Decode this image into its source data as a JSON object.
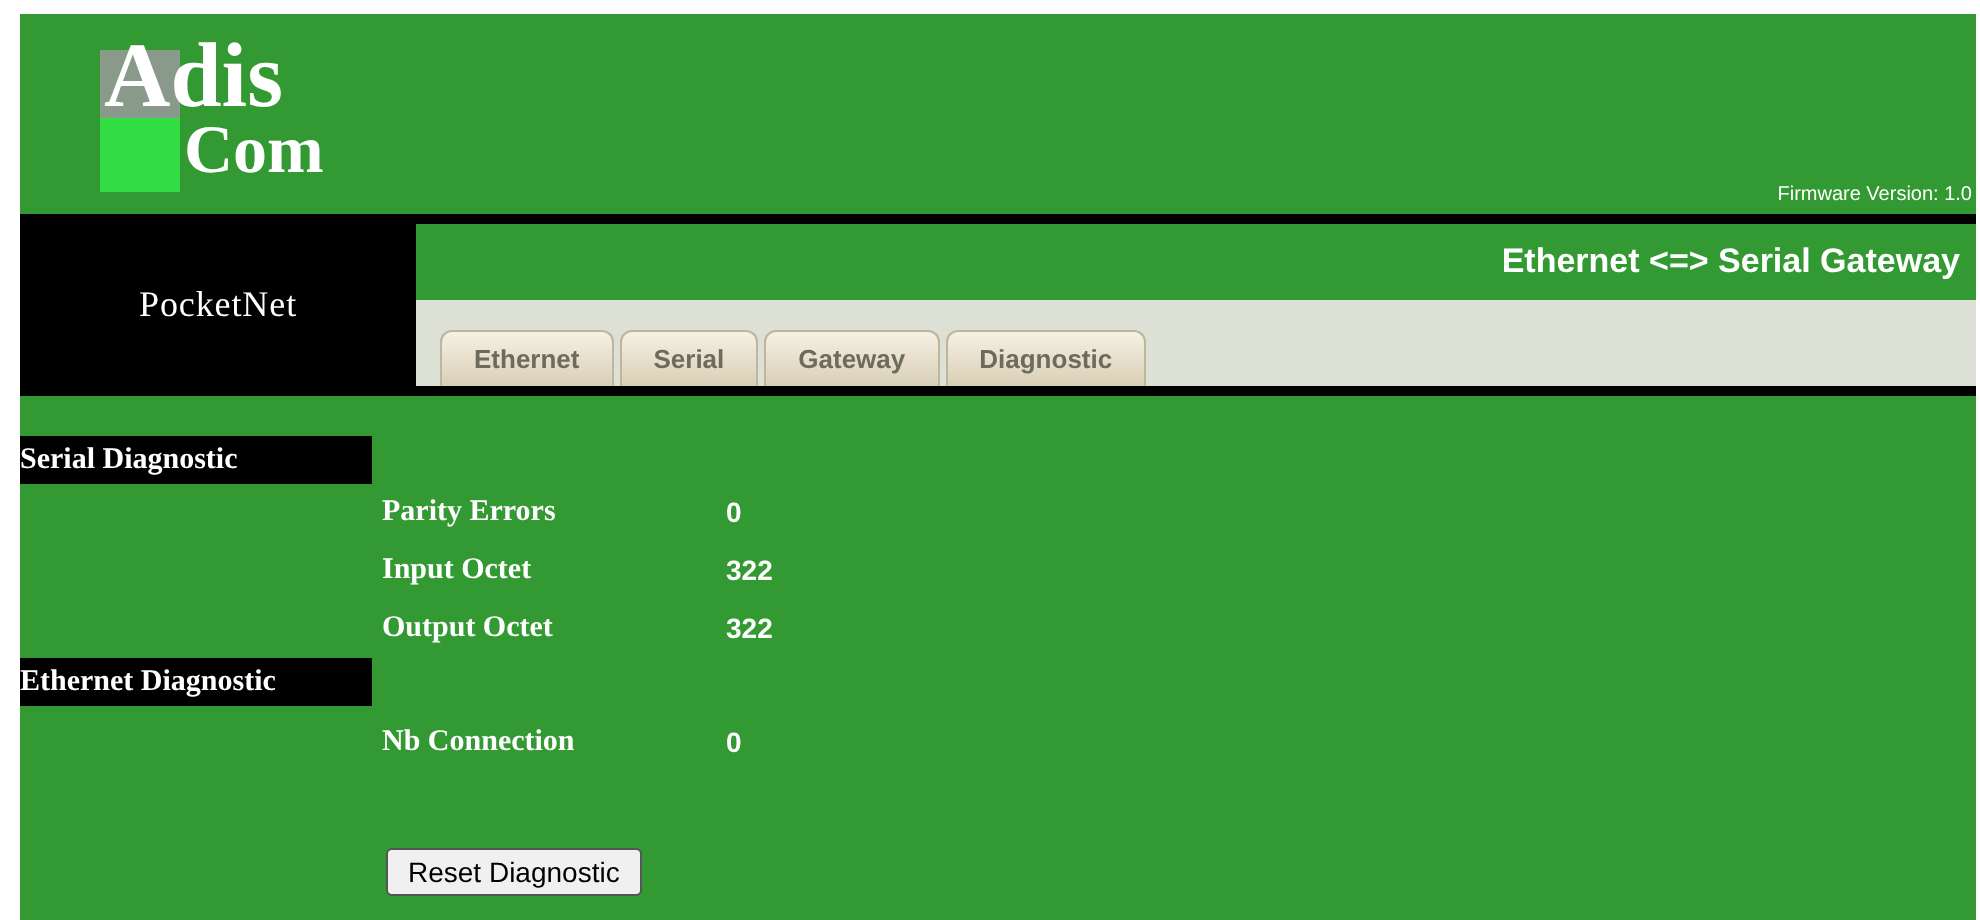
{
  "logo": {
    "line_1": "Adis",
    "line_2": "Com"
  },
  "firmware": "Firmware Version: 1.0",
  "product": "PocketNet",
  "title": "Ethernet <=> Serial Gateway",
  "tabs": [
    {
      "label": "Ethernet",
      "selected": false
    },
    {
      "label": "Serial",
      "selected": false
    },
    {
      "label": "Gateway",
      "selected": false
    },
    {
      "label": "Diagnostic",
      "selected": false
    }
  ],
  "sections": [
    {
      "title": "Serial Diagnostic",
      "rows": [
        {
          "label": "Parity Errors",
          "value": "0"
        },
        {
          "label": "Input Octet",
          "value": "322"
        },
        {
          "label": "Output Octet",
          "value": "322"
        }
      ]
    },
    {
      "title": "Ethernet Diagnostic",
      "rows": [
        {
          "label": "Nb Connection",
          "value": "0"
        }
      ]
    }
  ],
  "button": "Reset Diagnostic"
}
